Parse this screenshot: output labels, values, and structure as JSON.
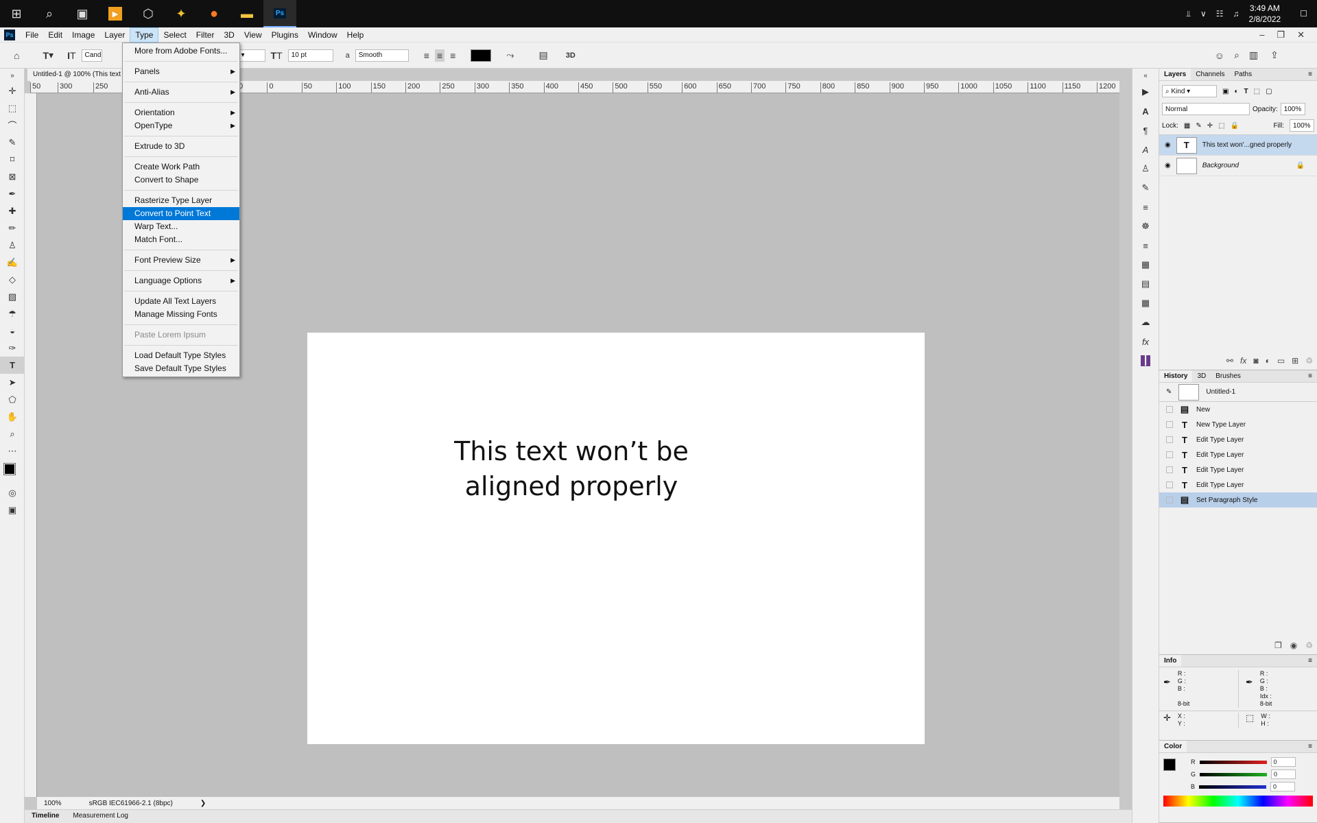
{
  "taskbar": {
    "time": "3:49 AM",
    "date": "2/8/2022"
  },
  "menubar": {
    "logo": "Ps",
    "items": [
      "File",
      "Edit",
      "Image",
      "Layer",
      "Type",
      "Select",
      "Filter",
      "3D",
      "View",
      "Plugins",
      "Window",
      "Help"
    ]
  },
  "options": {
    "font_family": "Cand",
    "font_size": "10 pt",
    "anti_alias": "Smooth",
    "three_d_label": "3D",
    "text_color": "#000000"
  },
  "document": {
    "tab_title": "Untitled-1 @ 100% (This text v",
    "canvas_text_line1": "This text won’t be",
    "canvas_text_line2": "aligned properly",
    "zoom": "100%",
    "color_profile": "sRGB IEC61966-2.1 (8bpc)"
  },
  "ruler_h_labels": [
    "50",
    "300",
    "250",
    "50",
    "0",
    "50",
    "100",
    "150",
    "200",
    "250",
    "300",
    "350",
    "400",
    "450",
    "500",
    "550",
    "600",
    "650",
    "700",
    "750",
    "800",
    "850",
    "900",
    "950",
    "1000",
    "1050",
    "1100",
    "1150",
    "1200"
  ],
  "type_menu": {
    "items": [
      {
        "label": "More from Adobe Fonts...",
        "arrow": false
      },
      {
        "sep": true
      },
      {
        "label": "Panels",
        "arrow": true
      },
      {
        "sep": true
      },
      {
        "label": "Anti-Alias",
        "arrow": true
      },
      {
        "sep": true
      },
      {
        "label": "Orientation",
        "arrow": true
      },
      {
        "label": "OpenType",
        "arrow": true
      },
      {
        "sep": true
      },
      {
        "label": "Extrude to 3D",
        "arrow": false
      },
      {
        "sep": true
      },
      {
        "label": "Create Work Path",
        "arrow": false
      },
      {
        "label": "Convert to Shape",
        "arrow": false
      },
      {
        "sep": true
      },
      {
        "label": "Rasterize Type Layer",
        "arrow": false
      },
      {
        "label": "Convert to Point Text",
        "arrow": false,
        "highlighted": true
      },
      {
        "label": "Warp Text...",
        "arrow": false
      },
      {
        "label": "Match Font...",
        "arrow": false
      },
      {
        "sep": true
      },
      {
        "label": "Font Preview Size",
        "arrow": true
      },
      {
        "sep": true
      },
      {
        "label": "Language Options",
        "arrow": true
      },
      {
        "sep": true
      },
      {
        "label": "Update All Text Layers",
        "arrow": false
      },
      {
        "label": "Manage Missing Fonts",
        "arrow": false
      },
      {
        "sep": true
      },
      {
        "label": "Paste Lorem Ipsum",
        "arrow": false,
        "disabled": true
      },
      {
        "sep": true
      },
      {
        "label": "Load Default Type Styles",
        "arrow": false
      },
      {
        "label": "Save Default Type Styles",
        "arrow": false
      }
    ]
  },
  "layers_panel": {
    "tabs": [
      "Layers",
      "Channels",
      "Paths"
    ],
    "filter": "Kind",
    "blend_mode": "Normal",
    "opacity_label": "Opacity:",
    "opacity": "100%",
    "lock_label": "Lock:",
    "fill_label": "Fill:",
    "fill": "100%",
    "layers": [
      {
        "name": "This text won'...gned properly",
        "thumb": "T",
        "selected": true
      },
      {
        "name": "Background",
        "thumb": "",
        "selected": false,
        "locked": true
      }
    ]
  },
  "history_panel": {
    "tabs": [
      "History",
      "3D",
      "Brushes"
    ],
    "snapshot": "Untitled-1",
    "states": [
      {
        "label": "New",
        "icon": "doc"
      },
      {
        "label": "New Type Layer",
        "icon": "T"
      },
      {
        "label": "Edit Type Layer",
        "icon": "T"
      },
      {
        "label": "Edit Type Layer",
        "icon": "T"
      },
      {
        "label": "Edit Type Layer",
        "icon": "T"
      },
      {
        "label": "Edit Type Layer",
        "icon": "T"
      },
      {
        "label": "Set Paragraph Style",
        "icon": "doc",
        "selected": true
      }
    ]
  },
  "info_panel": {
    "title": "Info",
    "rgb_left": [
      "R :",
      "G :",
      "B :"
    ],
    "rgb_right": [
      "R :",
      "G :",
      "B :",
      "Idx :"
    ],
    "bitdepth": "8-bit",
    "xy": [
      "X :",
      "Y :"
    ],
    "wh": [
      "W :",
      "H :"
    ]
  },
  "color_panel": {
    "title": "Color",
    "channels": [
      {
        "label": "R",
        "value": "0",
        "color": "#e02020"
      },
      {
        "label": "G",
        "value": "0",
        "color": "#20b020"
      },
      {
        "label": "B",
        "value": "0",
        "color": "#2030d0"
      }
    ]
  },
  "bottom_tabs": [
    "Timeline",
    "Measurement Log"
  ]
}
